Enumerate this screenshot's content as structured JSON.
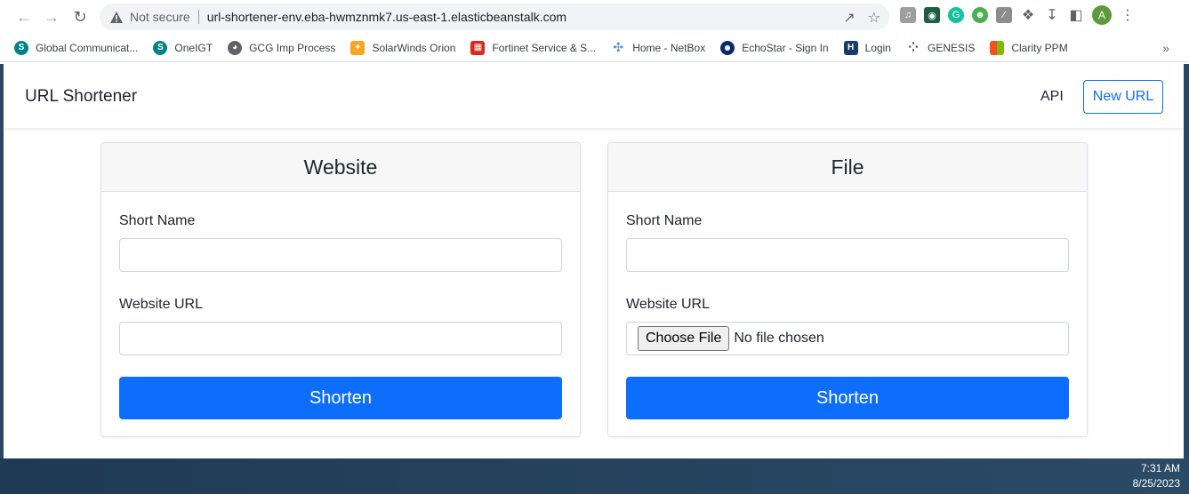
{
  "browser": {
    "security_label": "Not secure",
    "url": "url-shortener-env.eba-hwmznmk7.us-east-1.elasticbeanstalk.com",
    "profile_initial": "A"
  },
  "bookmarks": [
    {
      "label": "Global Communicat...",
      "icon": "sharepoint-icon",
      "color": "#038387",
      "glyph": "S"
    },
    {
      "label": "OneIGT",
      "icon": "sharepoint-icon",
      "color": "#038387",
      "glyph": "S"
    },
    {
      "label": "GCG Imp Process",
      "icon": "globe-icon",
      "color": "#5f6368",
      "glyph": "◍"
    },
    {
      "label": "SolarWinds Orion",
      "icon": "solarwinds-icon",
      "color": "#f5a623",
      "glyph": "✦"
    },
    {
      "label": "Fortinet Service & S...",
      "icon": "fortinet-icon",
      "color": "#da291c",
      "glyph": "▦"
    },
    {
      "label": "Home - NetBox",
      "icon": "netbox-icon",
      "color": "#4a90e2",
      "glyph": "✣"
    },
    {
      "label": "EchoStar - Sign In",
      "icon": "echostar-icon",
      "color": "#0a2a6b",
      "glyph": "●"
    },
    {
      "label": "Login",
      "icon": "login-icon",
      "color": "#1a3a6b",
      "glyph": "H"
    },
    {
      "label": "GENESIS",
      "icon": "genesis-icon",
      "color": "#1e4ea0",
      "glyph": "⁘"
    },
    {
      "label": "Clarity PPM",
      "icon": "clarity-icon",
      "color": "#f25022",
      "glyph": "▦"
    }
  ],
  "navbar": {
    "brand": "URL Shortener",
    "api_link": "API",
    "new_url_button": "New URL"
  },
  "website_card": {
    "title": "Website",
    "short_name_label": "Short Name",
    "short_name_value": "",
    "url_label": "Website URL",
    "url_value": "",
    "submit": "Shorten"
  },
  "file_card": {
    "title": "File",
    "short_name_label": "Short Name",
    "short_name_value": "",
    "url_label": "Website URL",
    "choose_file": "Choose File",
    "file_status": "No file chosen",
    "submit": "Shorten"
  },
  "taskbar": {
    "time": "7:31 AM",
    "date": "8/25/2023"
  },
  "colors": {
    "primary": "#0d6efd",
    "card_header": "#f7f7f7",
    "taskbar": "#203a54"
  }
}
